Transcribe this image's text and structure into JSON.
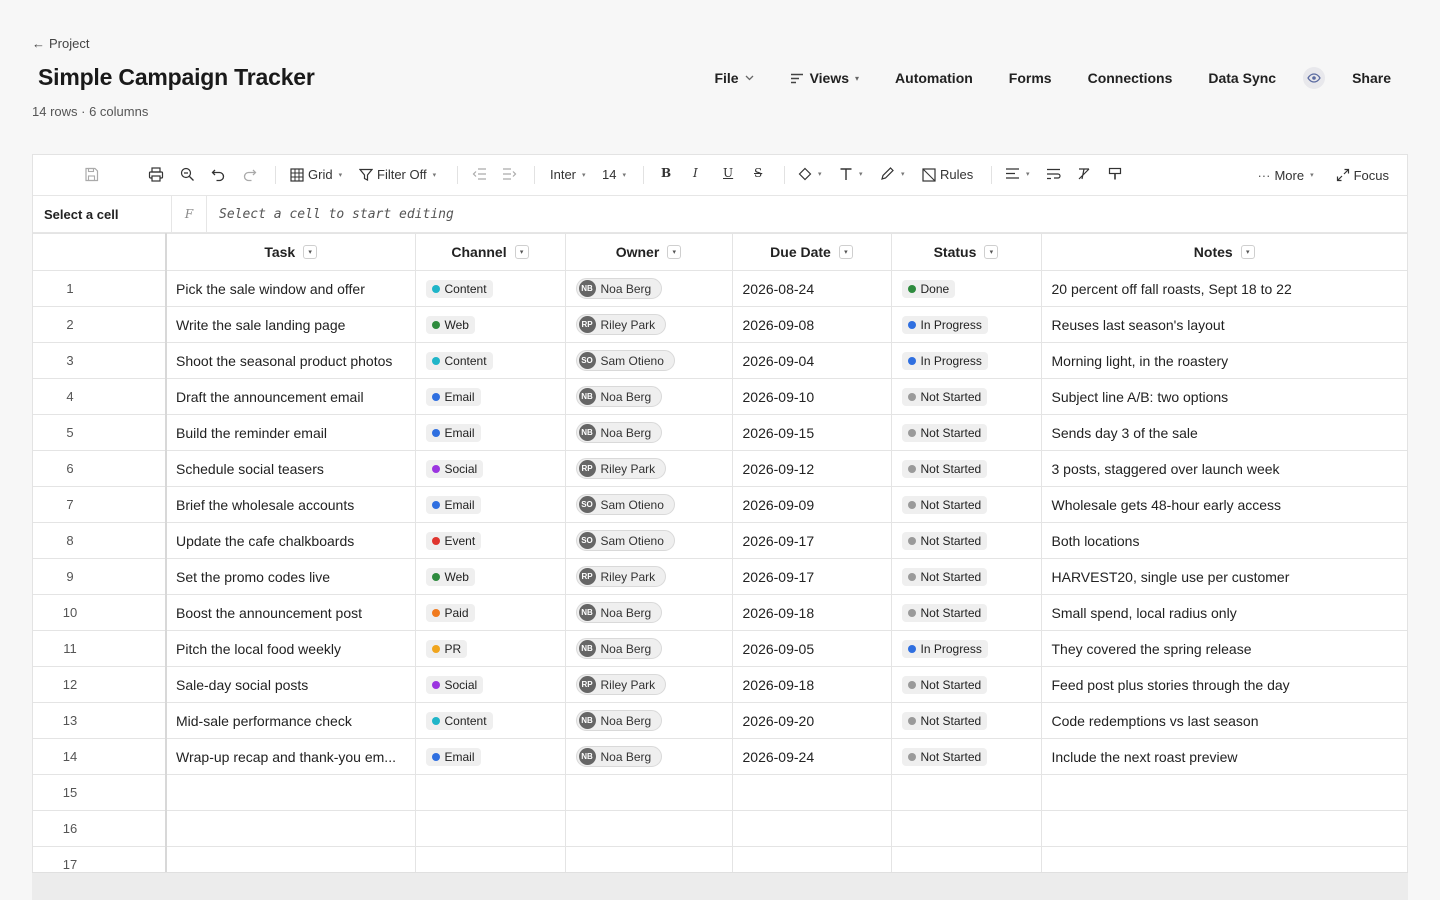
{
  "nav": {
    "back_label": "Project",
    "title": "Simple Campaign Tracker",
    "meta": "14 rows · 6 columns",
    "items": {
      "file": "File",
      "views": "Views",
      "automation": "Automation",
      "forms": "Forms",
      "connections": "Connections",
      "data_sync": "Data Sync",
      "share": "Share"
    }
  },
  "toolbar": {
    "view_label": "Grid",
    "filter_label": "Filter Off",
    "font_name": "Inter",
    "font_size": "14",
    "rules_label": "Rules",
    "more_label": "More",
    "focus_label": "Focus"
  },
  "formula": {
    "cell_ref": "Select a cell",
    "fx": "F",
    "placeholder": "Select a cell to start editing"
  },
  "columns": [
    "Task",
    "Channel",
    "Owner",
    "Due Date",
    "Status",
    "Notes"
  ],
  "rows": [
    {
      "num": "1",
      "task": "Pick the sale window and offer",
      "channel": "Content",
      "owner": "Noa Berg",
      "initials": "NB",
      "due": "2026-08-24",
      "status": "Done",
      "notes": "20 percent off fall roasts, Sept 18 to 22"
    },
    {
      "num": "2",
      "task": "Write the sale landing page",
      "channel": "Web",
      "owner": "Riley Park",
      "initials": "RP",
      "due": "2026-09-08",
      "status": "In Progress",
      "notes": "Reuses last season's layout"
    },
    {
      "num": "3",
      "task": "Shoot the seasonal product photos",
      "channel": "Content",
      "owner": "Sam Otieno",
      "initials": "SO",
      "due": "2026-09-04",
      "status": "In Progress",
      "notes": "Morning light, in the roastery"
    },
    {
      "num": "4",
      "task": "Draft the announcement email",
      "channel": "Email",
      "owner": "Noa Berg",
      "initials": "NB",
      "due": "2026-09-10",
      "status": "Not Started",
      "notes": "Subject line A/B: two options"
    },
    {
      "num": "5",
      "task": "Build the reminder email",
      "channel": "Email",
      "owner": "Noa Berg",
      "initials": "NB",
      "due": "2026-09-15",
      "status": "Not Started",
      "notes": "Sends day 3 of the sale"
    },
    {
      "num": "6",
      "task": "Schedule social teasers",
      "channel": "Social",
      "owner": "Riley Park",
      "initials": "RP",
      "due": "2026-09-12",
      "status": "Not Started",
      "notes": "3 posts, staggered over launch week"
    },
    {
      "num": "7",
      "task": "Brief the wholesale accounts",
      "channel": "Email",
      "owner": "Sam Otieno",
      "initials": "SO",
      "due": "2026-09-09",
      "status": "Not Started",
      "notes": "Wholesale gets 48-hour early access"
    },
    {
      "num": "8",
      "task": "Update the cafe chalkboards",
      "channel": "Event",
      "owner": "Sam Otieno",
      "initials": "SO",
      "due": "2026-09-17",
      "status": "Not Started",
      "notes": "Both locations"
    },
    {
      "num": "9",
      "task": "Set the promo codes live",
      "channel": "Web",
      "owner": "Riley Park",
      "initials": "RP",
      "due": "2026-09-17",
      "status": "Not Started",
      "notes": "HARVEST20, single use per customer"
    },
    {
      "num": "10",
      "task": "Boost the announcement post",
      "channel": "Paid",
      "owner": "Noa Berg",
      "initials": "NB",
      "due": "2026-09-18",
      "status": "Not Started",
      "notes": "Small spend, local radius only"
    },
    {
      "num": "11",
      "task": "Pitch the local food weekly",
      "channel": "PR",
      "owner": "Noa Berg",
      "initials": "NB",
      "due": "2026-09-05",
      "status": "In Progress",
      "notes": "They covered the spring release"
    },
    {
      "num": "12",
      "task": "Sale-day social posts",
      "channel": "Social",
      "owner": "Riley Park",
      "initials": "RP",
      "due": "2026-09-18",
      "status": "Not Started",
      "notes": "Feed post plus stories through the day"
    },
    {
      "num": "13",
      "task": "Mid-sale performance check",
      "channel": "Content",
      "owner": "Noa Berg",
      "initials": "NB",
      "due": "2026-09-20",
      "status": "Not Started",
      "notes": "Code redemptions vs last season"
    },
    {
      "num": "14",
      "task": "Wrap-up recap and thank-you em...",
      "channel": "Email",
      "owner": "Noa Berg",
      "initials": "NB",
      "due": "2026-09-24",
      "status": "Not Started",
      "notes": "Include the next roast preview"
    }
  ],
  "empty_rows": [
    "15",
    "16",
    "17"
  ],
  "channel_colors": {
    "Content": "#1fb5c8",
    "Web": "#2e8b3e",
    "Email": "#2f6fe0",
    "Social": "#9b35e0",
    "Event": "#e0352f",
    "Paid": "#f07a1e",
    "PR": "#f0a51e"
  },
  "status_colors": {
    "Done": "#2e8b3e",
    "In Progress": "#2f6fe0",
    "Not Started": "#9a9a9a"
  }
}
